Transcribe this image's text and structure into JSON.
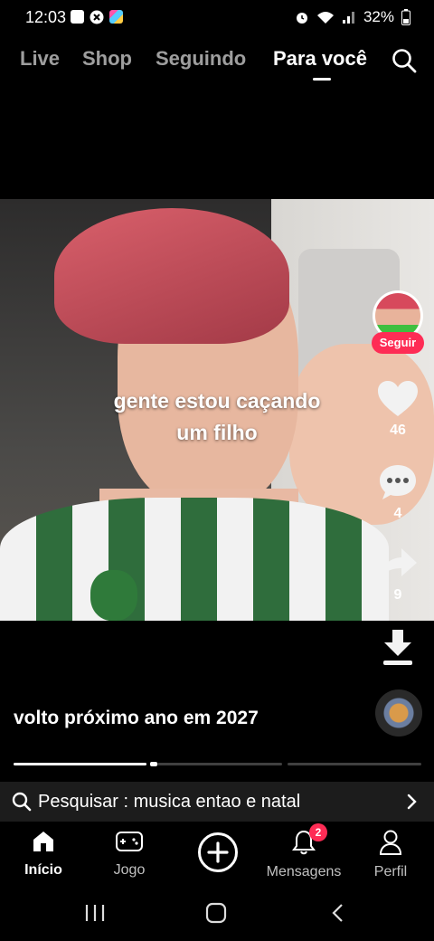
{
  "status_bar": {
    "time": "12:03",
    "battery": "32%",
    "left_icons": [
      "image-icon",
      "close-circle-icon",
      "app-icon"
    ],
    "right_icons": [
      "alarm-icon",
      "wifi-icon",
      "signal-icon",
      "battery-icon"
    ]
  },
  "top_nav": {
    "tabs": [
      {
        "label": "Live",
        "active": false
      },
      {
        "label": "Shop",
        "active": false
      },
      {
        "label": "Seguindo",
        "active": false
      },
      {
        "label": "Para você",
        "active": true
      }
    ],
    "search_icon": "search-icon"
  },
  "video": {
    "caption_line1": "gente estou caçando",
    "caption_line2": "um filho"
  },
  "right_rail": {
    "follow_label": "Seguir",
    "likes": "46",
    "comments": "4",
    "shares": "9"
  },
  "description": {
    "text": "volto  próximo  ano em 2027"
  },
  "search_suggestion": {
    "text": "Pesquisar : musica entao e natal"
  },
  "bottom_nav": {
    "items": [
      {
        "label": "Início",
        "icon": "home-icon",
        "active": true
      },
      {
        "label": "Jogo",
        "icon": "gamepad-icon",
        "active": false
      },
      {
        "label": "",
        "icon": "create-plus-icon",
        "active": false
      },
      {
        "label": "Mensagens",
        "icon": "bell-icon",
        "active": false
      },
      {
        "label": "Perfil",
        "icon": "person-icon",
        "active": false
      }
    ],
    "notification_count": "2"
  },
  "colors": {
    "accent": "#fe2c55",
    "background": "#000000",
    "searchbar": "#1c1c1c"
  }
}
